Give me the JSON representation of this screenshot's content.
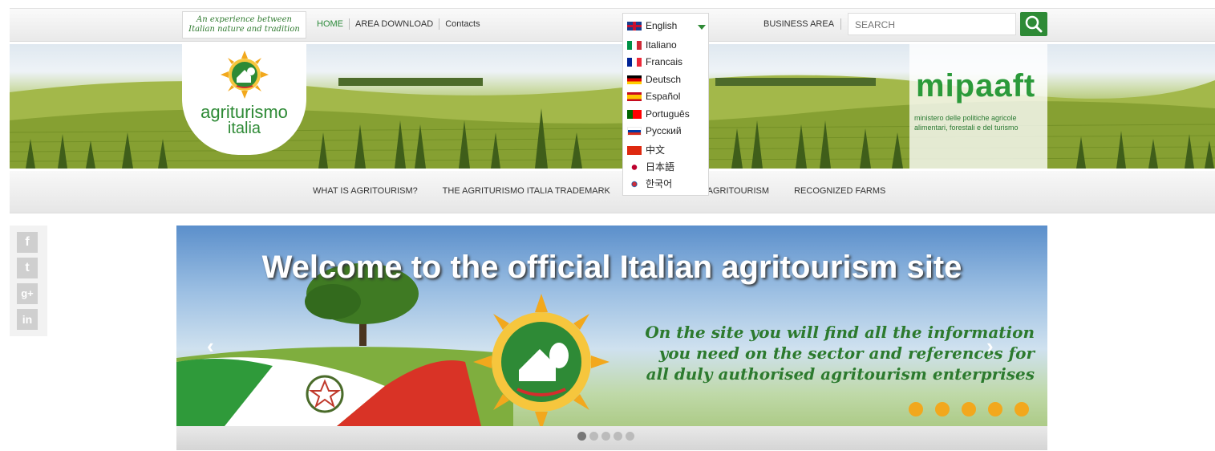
{
  "topbar": {
    "tagline": "An experience between Italian nature and tradition",
    "nav": [
      "HOME",
      "AREA DOWNLOAD",
      "Contacts"
    ],
    "business_area": "BUSINESS AREA",
    "search_placeholder": "SEARCH"
  },
  "language": {
    "selected": "English",
    "options": [
      "Italiano",
      "Francais",
      "Deutsch",
      "Español",
      "Português",
      "Русский",
      "中文",
      "日本語",
      "한국어"
    ]
  },
  "banner": {
    "logo_line1": "agriturismo",
    "logo_line2": "italia",
    "ministry_name": "mipaaft",
    "ministry_desc": "ministero delle politiche agricole alimentari, forestali e del turismo"
  },
  "mainnav": [
    "WHAT IS AGRITOURISM?",
    "THE AGRITURISMO ITALIA TRADEMARK",
    "ITALY THROUGH AGRITOURISM",
    "RECOGNIZED FARMS"
  ],
  "social": [
    "facebook-icon",
    "twitter-icon",
    "google-plus-icon",
    "linkedin-icon"
  ],
  "slider": {
    "title": "Welcome to the official Italian agritourism site",
    "line1": "On the site you will find all the information",
    "line2": "you need on the sector and references for",
    "line3": "all duly authorised agritourism enterprises",
    "slide_count": 5,
    "active_slide": 1
  },
  "colors": {
    "accent": "#2e8a36",
    "nav_text": "#333333"
  }
}
